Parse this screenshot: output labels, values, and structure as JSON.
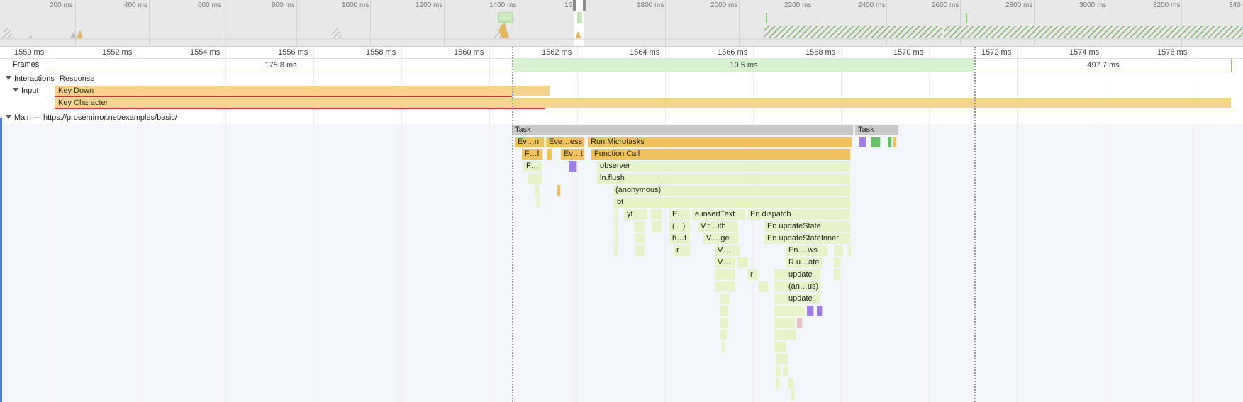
{
  "overview": {
    "ticks": [
      "200 ms",
      "400 ms",
      "600 ms",
      "800 ms",
      "1000 ms",
      "1200 ms",
      "1400 ms",
      "16",
      "",
      "1800 ms",
      "2000 ms",
      "2200 ms",
      "2400 ms",
      "2600 ms",
      "2800 ms",
      "3000 ms",
      "3200 ms",
      "340"
    ]
  },
  "ruler": {
    "ticks": [
      "1550 ms",
      "1552 ms",
      "1554 ms",
      "1556 ms",
      "1558 ms",
      "1560 ms",
      "1562 ms",
      "1564 ms",
      "1566 ms",
      "1568 ms",
      "1570 ms",
      "1572 ms",
      "1574 ms",
      "1576 ms"
    ]
  },
  "frames": {
    "label": "Frames",
    "segments": [
      "175.8 ms",
      "10.5 ms",
      "497.7 ms"
    ]
  },
  "interactions": {
    "label": "Interactions",
    "response_label": "Response"
  },
  "input": {
    "label": "Input",
    "key_down": "Key Down",
    "key_character": "Key Character"
  },
  "main": {
    "label": "Main — https://prosemirror.net/examples/basic/"
  },
  "flame": {
    "task1": "Task",
    "task2": "Task",
    "r1": [
      "Ev…n",
      "Eve…ess",
      "Run Microtasks"
    ],
    "r2": [
      "F…l",
      "Ev…t",
      "Function Call"
    ],
    "r3": [
      "F…",
      "observer"
    ],
    "r4": [
      "ln.flush"
    ],
    "r5": [
      "(anonymous)"
    ],
    "r6": [
      "bt"
    ],
    "r7": [
      "yt",
      "E…",
      "e.insertText",
      "En.dispatch"
    ],
    "r8": [
      "(…)",
      "V.r…ith",
      "En.updateState"
    ],
    "r9": [
      "h…t",
      "V.…ge",
      "En.updateStateInner"
    ],
    "r10": [
      "r",
      "V…",
      "En.…ws"
    ],
    "r11": [
      "V…",
      "R.u…ate"
    ],
    "r12": [
      "r",
      "update"
    ],
    "r13": [
      "(an…us)"
    ],
    "r14": [
      "update"
    ]
  },
  "colors": {
    "task": "#c9c9c9",
    "scripting": "#efc25b",
    "function": "#e6f4c7",
    "input": "#f5d38d",
    "rendering": "#a07ee6",
    "painting": "#6cc06c",
    "frame": "#d6f2cf"
  }
}
